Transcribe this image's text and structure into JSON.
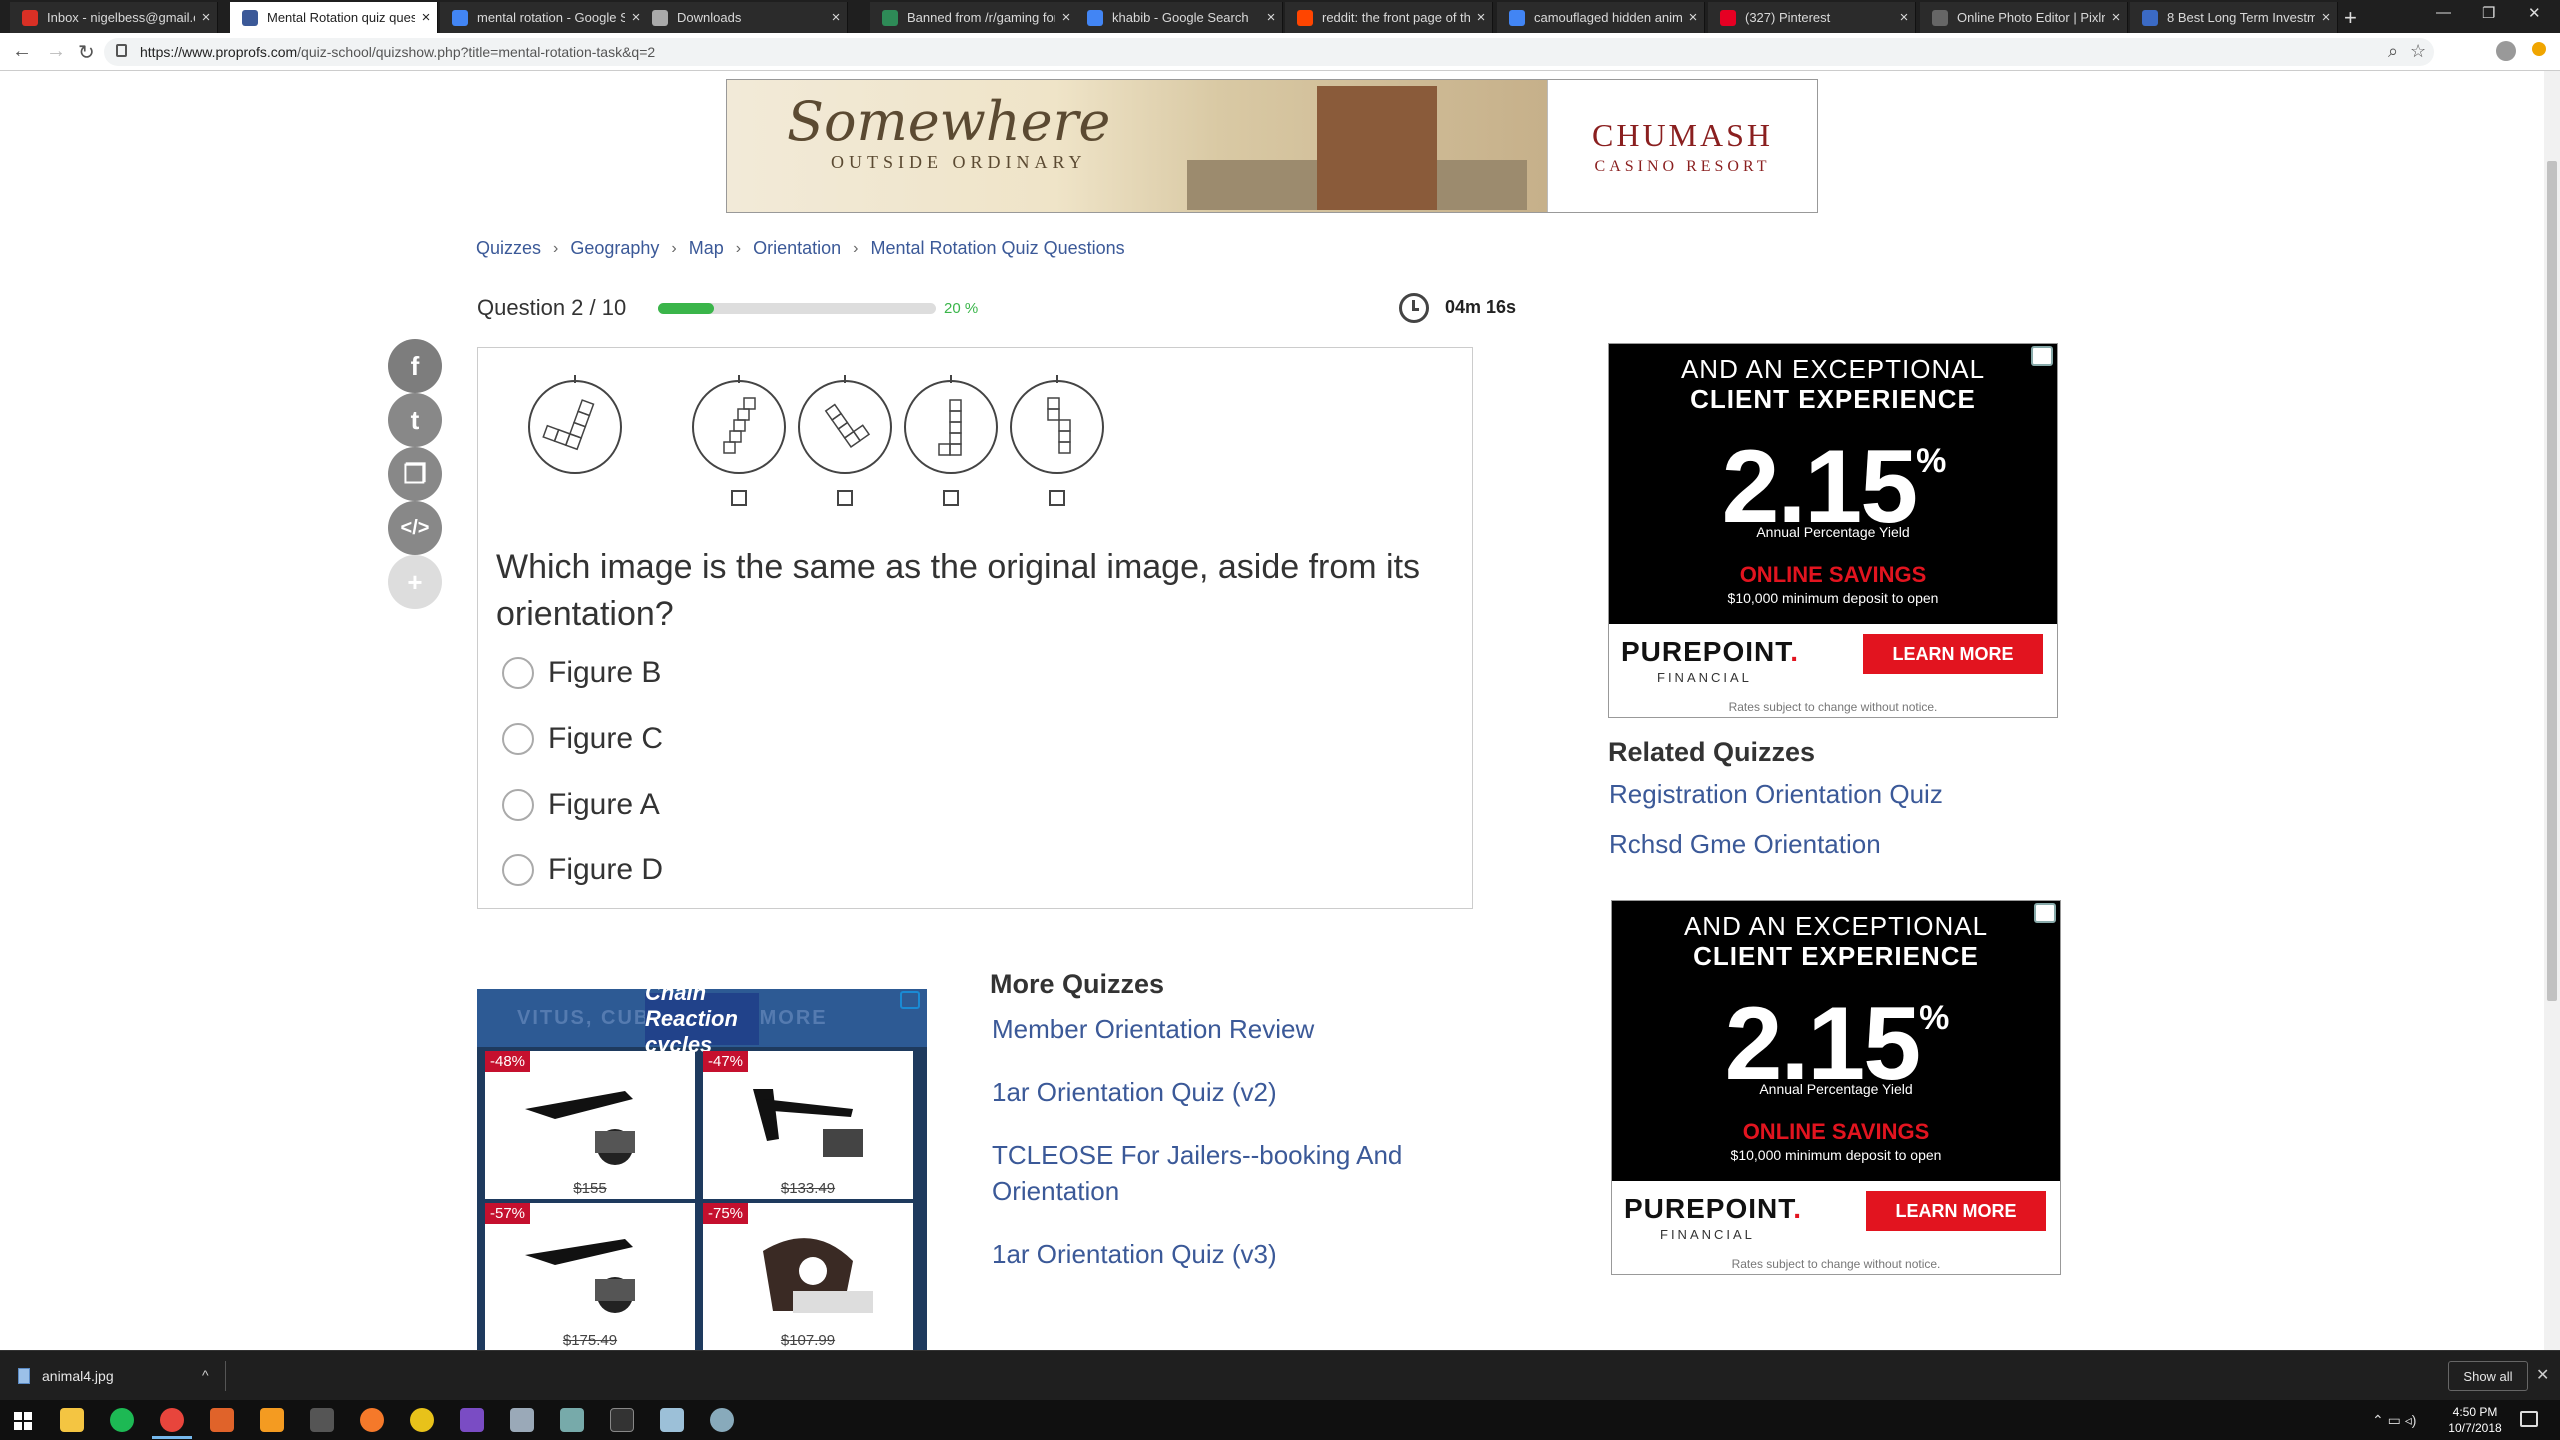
{
  "browser": {
    "tabs": [
      {
        "label": "Inbox - nigelbess@gmail.c",
        "color": "#d93025"
      },
      {
        "label": "Mental Rotation quiz questi",
        "color": "#3b5998",
        "active": true
      },
      {
        "label": "mental rotation - Google S",
        "color": "#4285f4"
      },
      {
        "label": "Downloads",
        "color": "#aaaaaa"
      },
      {
        "label": "Banned from /r/gaming for",
        "color": "#2e8b57"
      },
      {
        "label": "khabib - Google Search",
        "color": "#4285f4"
      },
      {
        "label": "reddit: the front page of th",
        "color": "#ff4500"
      },
      {
        "label": "camouflaged hidden anima",
        "color": "#4285f4"
      },
      {
        "label": "(327) Pinterest",
        "color": "#e60023"
      },
      {
        "label": "Online Photo Editor | Pixlr E",
        "color": "#666666"
      },
      {
        "label": "8 Best Long Term Investme",
        "color": "#3b6ac4"
      }
    ],
    "url_host": "https://www.proprofs.com",
    "url_path": "/quiz-school/quizshow.php?title=mental-rotation-task&q=2"
  },
  "banner": {
    "script": "Somewhere",
    "sub": "OUTSIDE ORDINARY",
    "brand": "CHUMASH",
    "brand_sub": "CASINO RESORT"
  },
  "breadcrumb": [
    "Quizzes",
    "Geography",
    "Map",
    "Orientation",
    "Mental Rotation Quiz Questions"
  ],
  "breadcrumb_sep": "›",
  "quiz": {
    "counter": "Question 2 / 10",
    "progress": 0.2,
    "progress_label": "20 %",
    "timer": "04m 16s",
    "question": "Which image is the same as the original image, aside from its orientation?",
    "options": [
      "Figure B",
      "Figure C",
      "Figure A",
      "Figure D"
    ]
  },
  "share_icons": [
    "facebook-icon",
    "twitter-icon",
    "copy-icon",
    "embed-icon",
    "plus-icon"
  ],
  "share_glyphs": [
    "f",
    "t",
    "❐",
    "</>",
    "+"
  ],
  "ad_left": {
    "header": "VITUS, CUBE ... AND MORE",
    "logo": "Chain Reaction cycles",
    "products": [
      {
        "discount": "-48%",
        "price": "$155"
      },
      {
        "discount": "-47%",
        "price": "$133.49"
      },
      {
        "discount": "-57%",
        "price": "$175.49"
      },
      {
        "discount": "-75%",
        "price": "$107.99"
      }
    ]
  },
  "more_quizzes": {
    "title": "More Quizzes",
    "links": [
      "Member Orientation Review",
      "1ar Orientation Quiz (v2)",
      "TCLEOSE For Jailers--booking And Orientation",
      "1ar Orientation Quiz (v3)"
    ]
  },
  "ad_right": {
    "header_line1": "AND AN EXCEPTIONAL",
    "header_line2": "CLIENT EXPERIENCE",
    "rate": "2.15",
    "rate_unit": "%",
    "apy": "Annual Percentage Yield",
    "online": "ONLINE SAVINGS",
    "minimum": "$10,000 minimum deposit to open",
    "brand": "PUREPOINT",
    "brand_mark": ".",
    "financial": "FINANCIAL",
    "cta": "LEARN MORE",
    "disclaimer": "Rates subject to change without notice."
  },
  "related": {
    "title": "Related Quizzes",
    "links": [
      "Registration Orientation Quiz",
      "Rchsd Gme Orientation"
    ]
  },
  "downloads": {
    "file": "animal4.jpg",
    "show_all": "Show all"
  },
  "taskbar": {
    "time": "4:50 PM",
    "date": "10/7/2018"
  }
}
